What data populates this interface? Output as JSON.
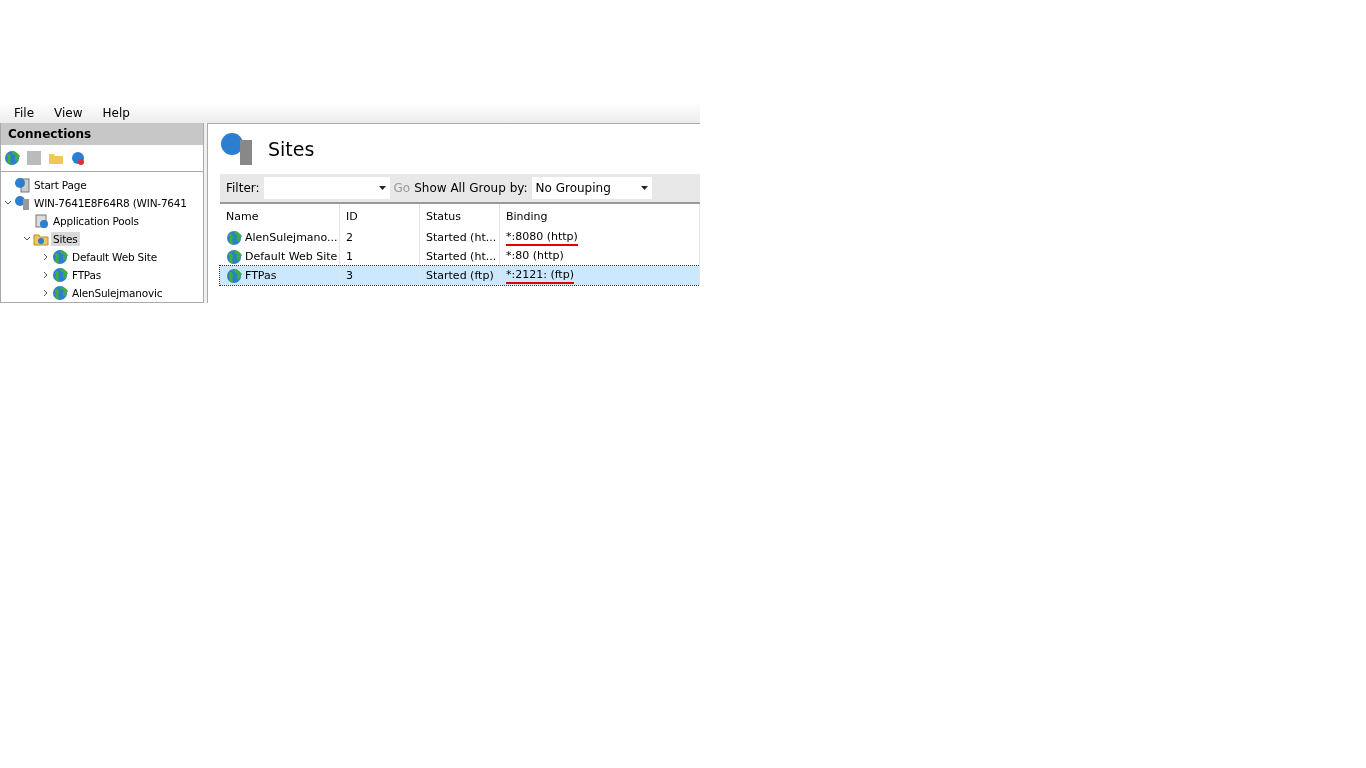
{
  "menu": [
    "File",
    "View",
    "Help"
  ],
  "connections": {
    "title": "Connections",
    "tree": [
      {
        "label": "Start Page",
        "kind": "page",
        "selected": false
      },
      {
        "label": "WIN-7641E8F64R8 (WIN-7641",
        "kind": "server",
        "selected": false,
        "expanded": true,
        "children": [
          {
            "label": "Application Pools",
            "kind": "pools",
            "selected": false
          },
          {
            "label": "Sites",
            "kind": "folder",
            "selected": true,
            "expanded": true,
            "children": [
              {
                "label": "Default Web Site",
                "kind": "site",
                "selected": false,
                "expanded": false
              },
              {
                "label": "FTPas",
                "kind": "site",
                "selected": false,
                "expanded": false
              },
              {
                "label": "AlenSulejmanovic",
                "kind": "site",
                "selected": false,
                "expanded": false
              }
            ]
          }
        ]
      }
    ]
  },
  "page": {
    "title": "Sites",
    "filter": {
      "label": "Filter:",
      "go": "Go",
      "show_all": "Show All",
      "group_by_label": "Group by:",
      "group_by_value": "No Grouping"
    },
    "columns": [
      "Name",
      "ID",
      "Status",
      "Binding"
    ],
    "rows": [
      {
        "name": "AlenSulejmano...",
        "id": "2",
        "status": "Started (ht...",
        "binding": "*:8080 (http)",
        "selected": false,
        "underlined": true
      },
      {
        "name": "Default Web Site",
        "id": "1",
        "status": "Started (ht...",
        "binding": "*:80 (http)",
        "selected": false,
        "underlined": false
      },
      {
        "name": "FTPas",
        "id": "3",
        "status": "Started (ftp)",
        "binding": "*:2121: (ftp)",
        "selected": true,
        "underlined": true
      }
    ]
  }
}
